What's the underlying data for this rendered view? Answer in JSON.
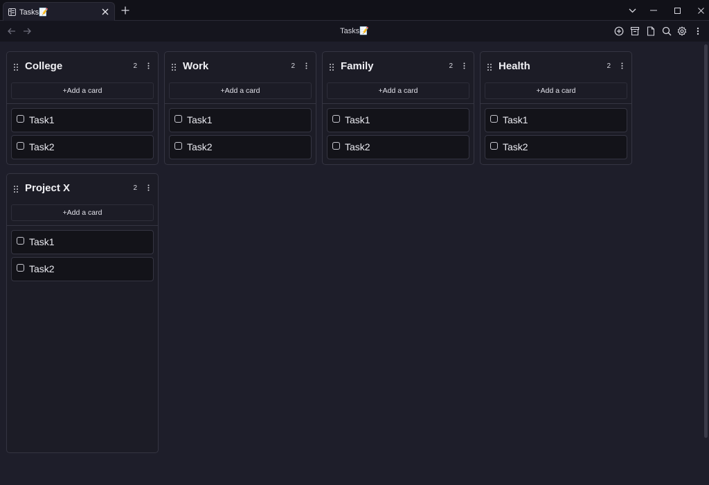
{
  "tab": {
    "title": "Tasks📝"
  },
  "window": {
    "title": "Tasks📝"
  },
  "icons": {
    "tab": "kanban-icon",
    "close": "close-icon",
    "new_tab": "plus-icon",
    "dropdown": "chevron-down-icon",
    "minimize": "minimize-icon",
    "maximize": "maximize-icon",
    "window_close": "close-icon",
    "back": "arrow-left-icon",
    "forward": "arrow-right-icon",
    "add": "add-circle-icon",
    "archive": "archive-icon",
    "markdown": "document-icon",
    "search": "search-icon",
    "settings": "gear-icon",
    "more": "more-vertical-icon"
  },
  "board": {
    "add_card_label": "+Add a card",
    "lanes": [
      {
        "title": "College",
        "count": "2",
        "cards": [
          "Task1",
          "Task2"
        ]
      },
      {
        "title": "Work",
        "count": "2",
        "cards": [
          "Task1",
          "Task2"
        ]
      },
      {
        "title": "Family",
        "count": "2",
        "cards": [
          "Task1",
          "Task2"
        ]
      },
      {
        "title": "Health",
        "count": "2",
        "cards": [
          "Task1",
          "Task2"
        ]
      },
      {
        "title": "Project X",
        "count": "2",
        "cards": [
          "Task1",
          "Task2"
        ]
      }
    ]
  },
  "colors": {
    "background": "#1e1e2a",
    "lane_background": "#1c1c26",
    "card_background": "#131319",
    "border": "#353542",
    "text": "#e6e6ec"
  }
}
